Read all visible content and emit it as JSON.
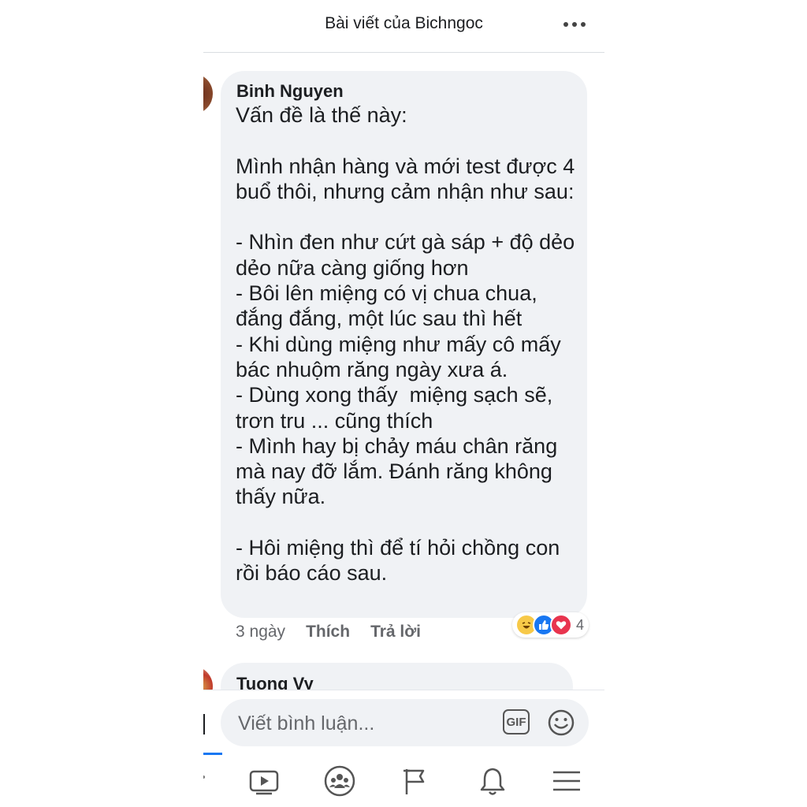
{
  "header": {
    "title": "Bài viết của Bichngoc",
    "more_icon": "more-horizontal-icon"
  },
  "comment": {
    "author": "Binh Nguyen",
    "text": "Vấn đề là thế này:\n\nMình nhận hàng và mới test được 4 buổ thôi, nhưng cảm nhận như sau:\n\n- Nhìn đen như cứt gà sáp + độ dẻo dẻo nữa càng giống hơn\n- Bôi lên miệng có vị chua chua, đắng đắng, một lúc sau thì hết\n- Khi dùng miệng như mấy cô mấy bác nhuộm răng ngày xưa á.\n- Dùng xong thấy  miệng sạch sẽ, trơn tru ... cũng thích\n- Mình hay bị chảy máu chân răng mà nay đỡ lắm. Đánh răng không thấy nữa.\n\n- Hôi miệng thì để tí hỏi chồng con rồi báo cáo sau.",
    "time": "3 ngày",
    "like_label": "Thích",
    "reply_label": "Trả lời",
    "reaction_count": "4",
    "reactions": [
      "haha-icon",
      "like-icon",
      "love-icon"
    ]
  },
  "next_comment": {
    "author": "Tuong Vy"
  },
  "composer": {
    "placeholder": "Viết bình luận...",
    "gif_label": "GIF",
    "emoji_icon": "smiley-icon"
  },
  "bottom_nav": [
    "video-icon",
    "groups-icon",
    "pages-flag-icon",
    "notifications-bell-icon",
    "menu-icon"
  ],
  "colors": {
    "bubble_bg": "#f0f2f5",
    "text": "#1c1e21",
    "secondary_text": "#65676b",
    "accent": "#1877f2",
    "love": "#e8344e",
    "haha": "#f7c948"
  }
}
